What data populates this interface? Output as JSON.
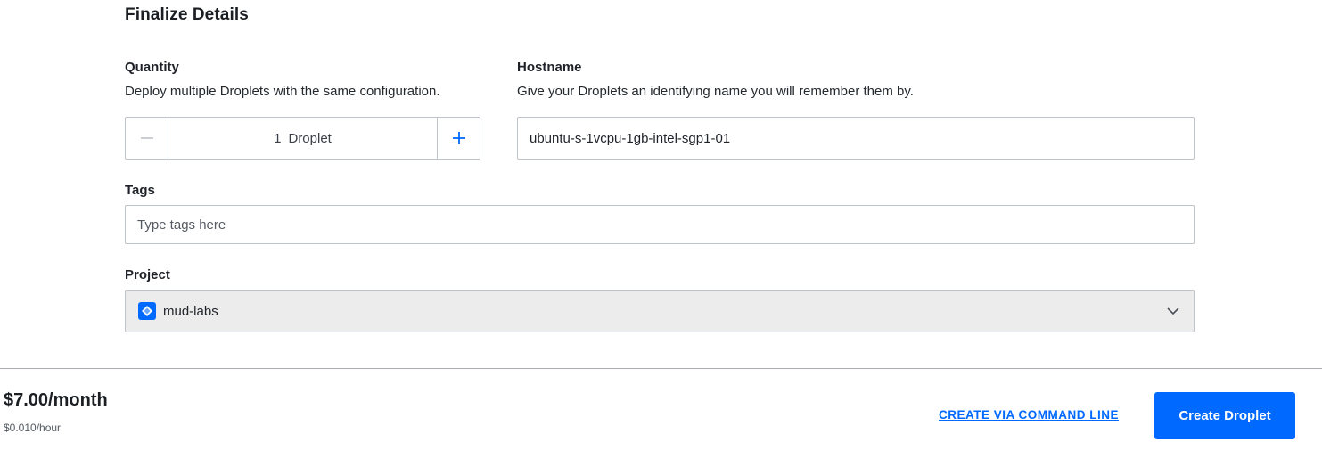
{
  "section": {
    "title": "Finalize Details"
  },
  "quantity": {
    "label": "Quantity",
    "help": "Deploy multiple Droplets with the same configuration.",
    "value": "1",
    "unit": "Droplet"
  },
  "hostname": {
    "label": "Hostname",
    "help": "Give your Droplets an identifying name you will remember them by.",
    "value": "ubuntu-s-1vcpu-1gb-intel-sgp1-01"
  },
  "tags": {
    "label": "Tags",
    "placeholder": "Type tags here"
  },
  "project": {
    "label": "Project",
    "selected": "mud-labs",
    "icon": "project-diamond-icon",
    "icon_color": "#0069ff"
  },
  "footer": {
    "price_month": "$7.00/month",
    "price_hour": "$0.010/hour",
    "cli_link": "CREATE VIA COMMAND LINE",
    "create_button": "Create Droplet",
    "accent": "#0069ff"
  }
}
